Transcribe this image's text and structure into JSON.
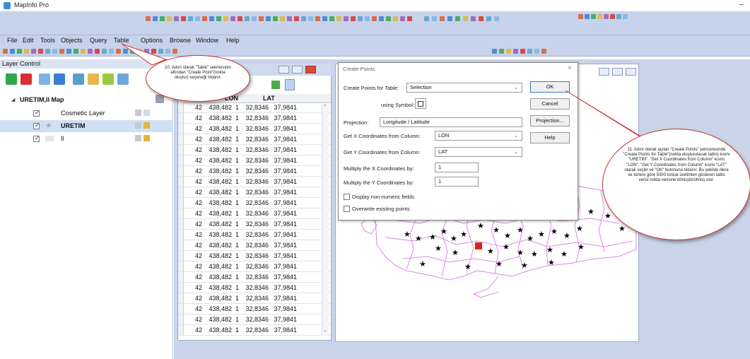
{
  "app": {
    "title": "MapInfo Pro",
    "minimize_glyph": "–"
  },
  "menu": [
    "File",
    "Edit",
    "Tools",
    "Objects",
    "Query",
    "Table",
    "Options",
    "Browse",
    "Window",
    "Help"
  ],
  "layer_control": {
    "title": "Layer Control",
    "map_name": "URETIM,Il Map",
    "layers": [
      {
        "name": "Cosmetic Layer",
        "checked": true,
        "bold": false
      },
      {
        "name": "URETIM",
        "checked": true,
        "bold": true
      },
      {
        "name": "Il",
        "checked": true,
        "bold": false
      }
    ]
  },
  "browser": {
    "columns": [
      "LON",
      "LAT"
    ],
    "rows": [
      [
        "42",
        "438,482",
        "1",
        "32,8346",
        "37,9841"
      ],
      [
        "42",
        "438,482",
        "1",
        "32,8346",
        "37,9841"
      ],
      [
        "42",
        "438,482",
        "1",
        "32,8346",
        "37,9841"
      ],
      [
        "42",
        "438,482",
        "1",
        "32,8346",
        "37,9841"
      ],
      [
        "42",
        "438,482",
        "1",
        "32,8346",
        "37,9841"
      ],
      [
        "42",
        "438,482",
        "1",
        "32,8346",
        "37,9841"
      ],
      [
        "42",
        "438,482",
        "1",
        "32,8346",
        "37,9841"
      ],
      [
        "42",
        "438,482",
        "1",
        "32,8346",
        "37,9841"
      ],
      [
        "42",
        "438,482",
        "1",
        "32,8346",
        "37,9841"
      ],
      [
        "42",
        "438,482",
        "1",
        "32,8346",
        "37,9841"
      ],
      [
        "42",
        "438,482",
        "1",
        "32,8346",
        "37,9841"
      ],
      [
        "42",
        "438,482",
        "1",
        "32,8346",
        "37,9841"
      ],
      [
        "42",
        "438,482",
        "1",
        "32,8346",
        "37,9841"
      ],
      [
        "42",
        "438,482",
        "1",
        "32,8346",
        "37,9841"
      ],
      [
        "42",
        "438,482",
        "1",
        "32,8346",
        "37,9841"
      ],
      [
        "42",
        "438,482",
        "1",
        "32,8346",
        "37,9841"
      ],
      [
        "42",
        "438,482",
        "1",
        "32,8346",
        "37,9841"
      ],
      [
        "42",
        "438,482",
        "1",
        "32,8346",
        "37,9841"
      ],
      [
        "42",
        "438,482",
        "1",
        "32,8346",
        "37,9841"
      ],
      [
        "42",
        "438,482",
        "1",
        "32,8346",
        "37,9841"
      ],
      [
        "42",
        "438,482",
        "1",
        "32,8346",
        "37,9841"
      ],
      [
        "42",
        "438,482",
        "1",
        "32,8346",
        "37,9841"
      ]
    ]
  },
  "dialog": {
    "title": "Create Points",
    "close_glyph": "×",
    "table_label": "Create Points for Table:",
    "table_value": "Selection",
    "symbol_label": "using Symbol:",
    "projection_label": "Projection:",
    "projection_value": "Longitude / Latitude",
    "x_label": "Get X Coordinates from Column:",
    "x_value": "LON",
    "y_label": "Get Y Coordinates from Column:",
    "y_value": "LAT",
    "mx_label": "Multiply the X Coordinates by:",
    "mx_value": "1",
    "my_label": "Multiply the Y Coordinates by:",
    "my_value": "1",
    "display_nonnumeric": "Display non-numeric fields",
    "overwrite": "Overwrite existing points",
    "ok": "OK",
    "cancel": "Cancel",
    "projection_btn": "Projection...",
    "help": "Help"
  },
  "callouts": {
    "step10": "10. Adım olarak \"Table\" sekmesinin altından \"Create Point\"(nokta oluştur) seçeneği tıklanır.",
    "step11": "11. Adım olarak açılan \"Create Points\" penceresinde \"Create Points for Table\"(nokta oluşturulacak tablo) kısmı \"URETIM\". \"Get X Coordinates from Column\" kısmı \"LON\", \"Get Y Coordinates from Column\" kısmı \"LAT\" olarak seçilir ve \"OK\" butonuna tıklanır. Bu şekilde illere ve türlere göre 5000 tonluk üretimleri gösteren tablo verisi nokta verisine dönüştürülmüş olur."
  },
  "colors": {
    "ribbon": "#c6d3ea",
    "map_border": "#d98be0",
    "highlight_row": "#cfe0f5",
    "callout_border": "#cc3333"
  }
}
